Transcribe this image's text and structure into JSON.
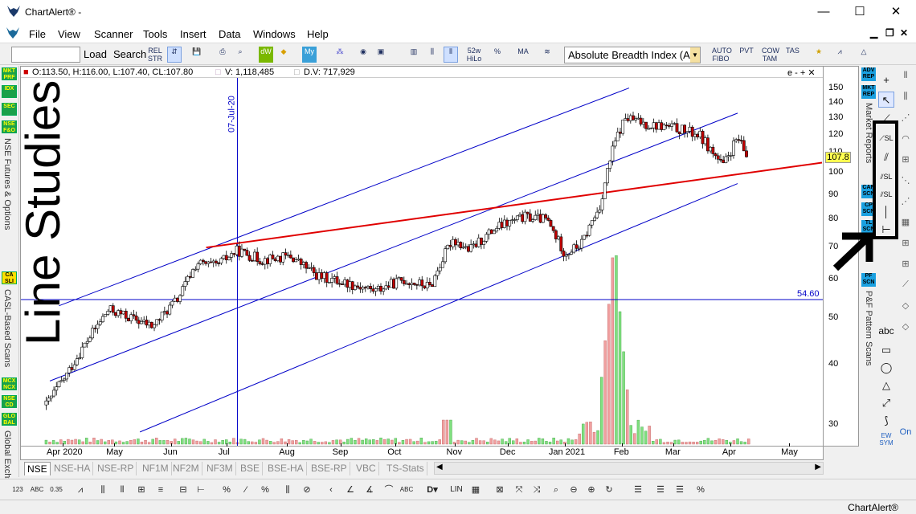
{
  "window": {
    "title": "ChartAlert® -",
    "min": "—",
    "max": "☐",
    "close": "✕"
  },
  "menu": [
    "File",
    "View",
    "Scanner",
    "Tools",
    "Insert",
    "Data",
    "Windows",
    "Help"
  ],
  "toolbar": {
    "load": "Load",
    "search": "Search",
    "rel_str": "REL STR",
    "wk52": "52w HiLo",
    "study_select": "Absolute Breadth Index (AB",
    "auto_fibo": "AUTO FIBO",
    "pvt": "PVT",
    "cow_tam": "COW TAM",
    "tas": "TAS"
  },
  "left_panel": {
    "buttons": [
      {
        "label": "MKT PRF"
      },
      {
        "label": "IDX"
      },
      {
        "label": "SEC"
      },
      {
        "label": "NSE F&O"
      },
      {
        "label": "CA SLI"
      },
      {
        "label": "MCX NCX"
      },
      {
        "label": "NSE CD"
      },
      {
        "label": "GLO BAL"
      }
    ],
    "labels": [
      "NSE Futures & Options",
      "CASL-Based Scans",
      "Global Exchs"
    ]
  },
  "chart_header": {
    "ohlc": "O:113.50, H:116.00, L:107.40, CL:107.80",
    "volume": "V: 1,118,485",
    "dvol": "D.V: 717,929",
    "controls": "e - + ✕",
    "vline_label": "07-Jul-20",
    "hline_label": "54.60",
    "price_tag": "107.8"
  },
  "overlay_annotation": "Line Studies",
  "chart_data": {
    "type": "candlestick",
    "y_scale": "log",
    "y_ticks": [
      150,
      140,
      130,
      120,
      110,
      100,
      90,
      80,
      70,
      60,
      50,
      40,
      30
    ],
    "ylim": [
      28,
      155
    ],
    "x_ticks": [
      "Apr 2020",
      "May",
      "Jun",
      "Jul",
      "Aug",
      "Sep",
      "Oct",
      "Nov",
      "Dec",
      "Jan 2021",
      "Feb",
      "Mar",
      "Apr",
      "May"
    ],
    "last_close": 107.8,
    "horizontal_line": 54.6,
    "vertical_line_date": "07-Jul-20",
    "close_approx": [
      [
        "2020-03-25",
        33
      ],
      [
        "2020-04-05",
        38
      ],
      [
        "2020-04-15",
        44
      ],
      [
        "2020-04-28",
        52
      ],
      [
        "2020-05-10",
        50
      ],
      [
        "2020-05-22",
        48
      ],
      [
        "2020-06-05",
        55
      ],
      [
        "2020-06-15",
        65
      ],
      [
        "2020-06-25",
        64
      ],
      [
        "2020-07-07",
        69
      ],
      [
        "2020-07-20",
        66
      ],
      [
        "2020-08-05",
        67
      ],
      [
        "2020-08-20",
        61
      ],
      [
        "2020-09-05",
        59
      ],
      [
        "2020-09-20",
        57
      ],
      [
        "2020-10-05",
        60
      ],
      [
        "2020-10-20",
        58
      ],
      [
        "2020-11-01",
        73
      ],
      [
        "2020-11-10",
        69
      ],
      [
        "2020-11-25",
        77
      ],
      [
        "2020-12-10",
        81
      ],
      [
        "2020-12-22",
        80
      ],
      [
        "2021-01-01",
        68
      ],
      [
        "2021-01-10",
        71
      ],
      [
        "2021-01-20",
        85
      ],
      [
        "2021-01-28",
        115
      ],
      [
        "2021-02-03",
        130
      ],
      [
        "2021-02-15",
        126
      ],
      [
        "2021-03-01",
        124
      ],
      [
        "2021-03-15",
        120
      ],
      [
        "2021-03-28",
        103
      ],
      [
        "2021-04-05",
        118
      ],
      [
        "2021-04-10",
        107.8
      ]
    ],
    "volume_spike_date": "2021-01-28"
  },
  "tabs": [
    "NSE",
    "NSE-HA",
    "NSE-RP",
    "NF1M",
    "NF2M",
    "NF3M",
    "BSE",
    "BSE-HA",
    "BSE-RP",
    "VBC",
    "TS-Stats"
  ],
  "right_panel": {
    "buttons": [
      {
        "label": "ADV REP"
      },
      {
        "label": "MKT REP"
      },
      {
        "label": "CAN SCN"
      },
      {
        "label": "CP SCN"
      },
      {
        "label": "TL SCN"
      },
      {
        "label": "PF SCN"
      }
    ],
    "labels": [
      "Market Reports",
      "P&F Pattern Scans"
    ],
    "on_label": "On",
    "ew_label": "EW SYM"
  },
  "draw_tools": [
    "crosshair",
    "pointer",
    "trendline",
    "sl-line",
    "channel",
    "sl-channel",
    "parallel",
    "sl-parallel",
    "vertical-line",
    "horizontal-line",
    "text",
    "rectangle",
    "ellipse",
    "triangle",
    "arrow",
    "cycle"
  ],
  "statusbar": {
    "brand": "ChartAlert®"
  },
  "colors": {
    "channel": "#0000c8",
    "red_trend": "#e00000",
    "up_candle": "#ffffff",
    "down_candle": "#c00000",
    "volume_up": "#80e080",
    "volume_down": "#f0a0a0"
  }
}
